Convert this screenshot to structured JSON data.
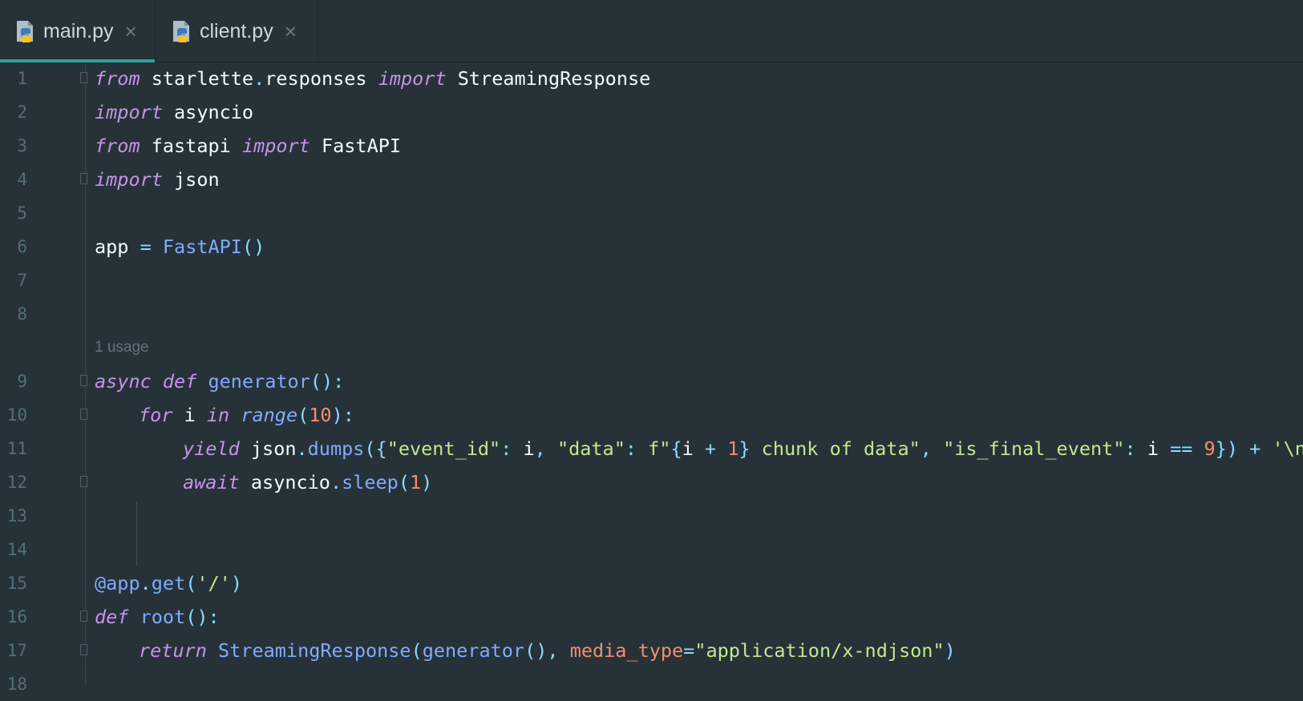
{
  "tabs": [
    {
      "label": "main.py",
      "active": true,
      "icon": "python-file-icon"
    },
    {
      "label": "client.py",
      "active": false,
      "icon": "python-file-icon"
    }
  ],
  "close_glyph": "×",
  "usage_hint": "1 usage",
  "code_lines": [
    {
      "n": "1",
      "indent": 0,
      "fold": "open",
      "tokens": [
        [
          "kw",
          "from"
        ],
        [
          "plain",
          " starlette"
        ],
        [
          "op",
          "."
        ],
        [
          "plain",
          "responses "
        ],
        [
          "kw",
          "import"
        ],
        [
          "plain",
          " StreamingResponse"
        ]
      ]
    },
    {
      "n": "2",
      "indent": 0,
      "tokens": [
        [
          "kw",
          "import"
        ],
        [
          "plain",
          " asyncio"
        ]
      ]
    },
    {
      "n": "3",
      "indent": 0,
      "tokens": [
        [
          "kw",
          "from"
        ],
        [
          "plain",
          " fastapi "
        ],
        [
          "kw",
          "import"
        ],
        [
          "plain",
          " FastAPI"
        ]
      ]
    },
    {
      "n": "4",
      "indent": 0,
      "fold": "close",
      "tokens": [
        [
          "kw",
          "import"
        ],
        [
          "plain",
          " json"
        ]
      ]
    },
    {
      "n": "5",
      "indent": 0,
      "tokens": []
    },
    {
      "n": "6",
      "indent": 0,
      "tokens": [
        [
          "plain",
          "app "
        ],
        [
          "op",
          "="
        ],
        [
          "plain",
          " "
        ],
        [
          "fn",
          "FastAPI"
        ],
        [
          "op",
          "()"
        ]
      ]
    },
    {
      "n": "7",
      "indent": 0,
      "tokens": []
    },
    {
      "n": "8",
      "indent": 0,
      "tokens": []
    },
    {
      "n": "",
      "hint": true,
      "tokens": []
    },
    {
      "n": "9",
      "indent": 0,
      "fold": "open",
      "tokens": [
        [
          "kw",
          "async"
        ],
        [
          "plain",
          " "
        ],
        [
          "kw",
          "def"
        ],
        [
          "plain",
          " "
        ],
        [
          "fn",
          "generator"
        ],
        [
          "op",
          "():"
        ]
      ]
    },
    {
      "n": "10",
      "indent": 1,
      "fold": "open",
      "tokens": [
        [
          "kw",
          "for"
        ],
        [
          "plain",
          " i "
        ],
        [
          "kw",
          "in"
        ],
        [
          "plain",
          " "
        ],
        [
          "bi",
          "range"
        ],
        [
          "op",
          "("
        ],
        [
          "num",
          "10"
        ],
        [
          "op",
          "):"
        ]
      ]
    },
    {
      "n": "11",
      "indent": 2,
      "tokens": [
        [
          "kw",
          "yield"
        ],
        [
          "plain",
          " json"
        ],
        [
          "op",
          "."
        ],
        [
          "fn",
          "dumps"
        ],
        [
          "op",
          "({"
        ],
        [
          "str",
          "\"event_id\""
        ],
        [
          "op",
          ":"
        ],
        [
          "plain",
          " i"
        ],
        [
          "op",
          ","
        ],
        [
          "plain",
          " "
        ],
        [
          "str",
          "\"data\""
        ],
        [
          "op",
          ":"
        ],
        [
          "plain",
          " "
        ],
        [
          "str",
          "f\""
        ],
        [
          "op",
          "{"
        ],
        [
          "plain",
          "i "
        ],
        [
          "op",
          "+"
        ],
        [
          "plain",
          " "
        ],
        [
          "num",
          "1"
        ],
        [
          "op",
          "}"
        ],
        [
          "str",
          " chunk of data\""
        ],
        [
          "op",
          ","
        ],
        [
          "plain",
          " "
        ],
        [
          "str",
          "\"is_final_event\""
        ],
        [
          "op",
          ":"
        ],
        [
          "plain",
          " i "
        ],
        [
          "op",
          "=="
        ],
        [
          "plain",
          " "
        ],
        [
          "num",
          "9"
        ],
        [
          "op",
          "})"
        ],
        [
          "plain",
          " "
        ],
        [
          "op",
          "+"
        ],
        [
          "plain",
          " "
        ],
        [
          "str",
          "'\\n'"
        ]
      ]
    },
    {
      "n": "12",
      "indent": 2,
      "fold": "close",
      "tokens": [
        [
          "kw",
          "await"
        ],
        [
          "plain",
          " asyncio"
        ],
        [
          "op",
          "."
        ],
        [
          "fn",
          "sleep"
        ],
        [
          "op",
          "("
        ],
        [
          "num",
          "1"
        ],
        [
          "op",
          ")"
        ]
      ]
    },
    {
      "n": "13",
      "indent": 0,
      "tokens": []
    },
    {
      "n": "14",
      "indent": 0,
      "tokens": []
    },
    {
      "n": "15",
      "indent": 0,
      "tokens": [
        [
          "fn",
          "@app"
        ],
        [
          "op",
          "."
        ],
        [
          "fn",
          "get"
        ],
        [
          "op",
          "("
        ],
        [
          "str",
          "'/'"
        ],
        [
          "op",
          ")"
        ]
      ]
    },
    {
      "n": "16",
      "indent": 0,
      "fold": "open",
      "tokens": [
        [
          "kw",
          "def"
        ],
        [
          "plain",
          " "
        ],
        [
          "fn",
          "root"
        ],
        [
          "op",
          "():"
        ]
      ]
    },
    {
      "n": "17",
      "indent": 1,
      "fold": "close",
      "tokens": [
        [
          "kw",
          "return"
        ],
        [
          "plain",
          " "
        ],
        [
          "fn",
          "StreamingResponse"
        ],
        [
          "op",
          "("
        ],
        [
          "fn",
          "generator"
        ],
        [
          "op",
          "(),"
        ],
        [
          "plain",
          " "
        ],
        [
          "prm",
          "media_type"
        ],
        [
          "op",
          "="
        ],
        [
          "str",
          "\"application/x-ndjson\""
        ],
        [
          "op",
          ")"
        ]
      ]
    },
    {
      "n": "18",
      "indent": 0,
      "tokens": []
    }
  ],
  "colors": {
    "background": "#263238",
    "keyword": "#c792ea",
    "function": "#82aaff",
    "string": "#c3e88d",
    "number": "#f78c6c",
    "operator": "#89ddff",
    "text": "#eeffff",
    "line_number": "#546e7a",
    "active_tab_accent": "#26a69a"
  }
}
